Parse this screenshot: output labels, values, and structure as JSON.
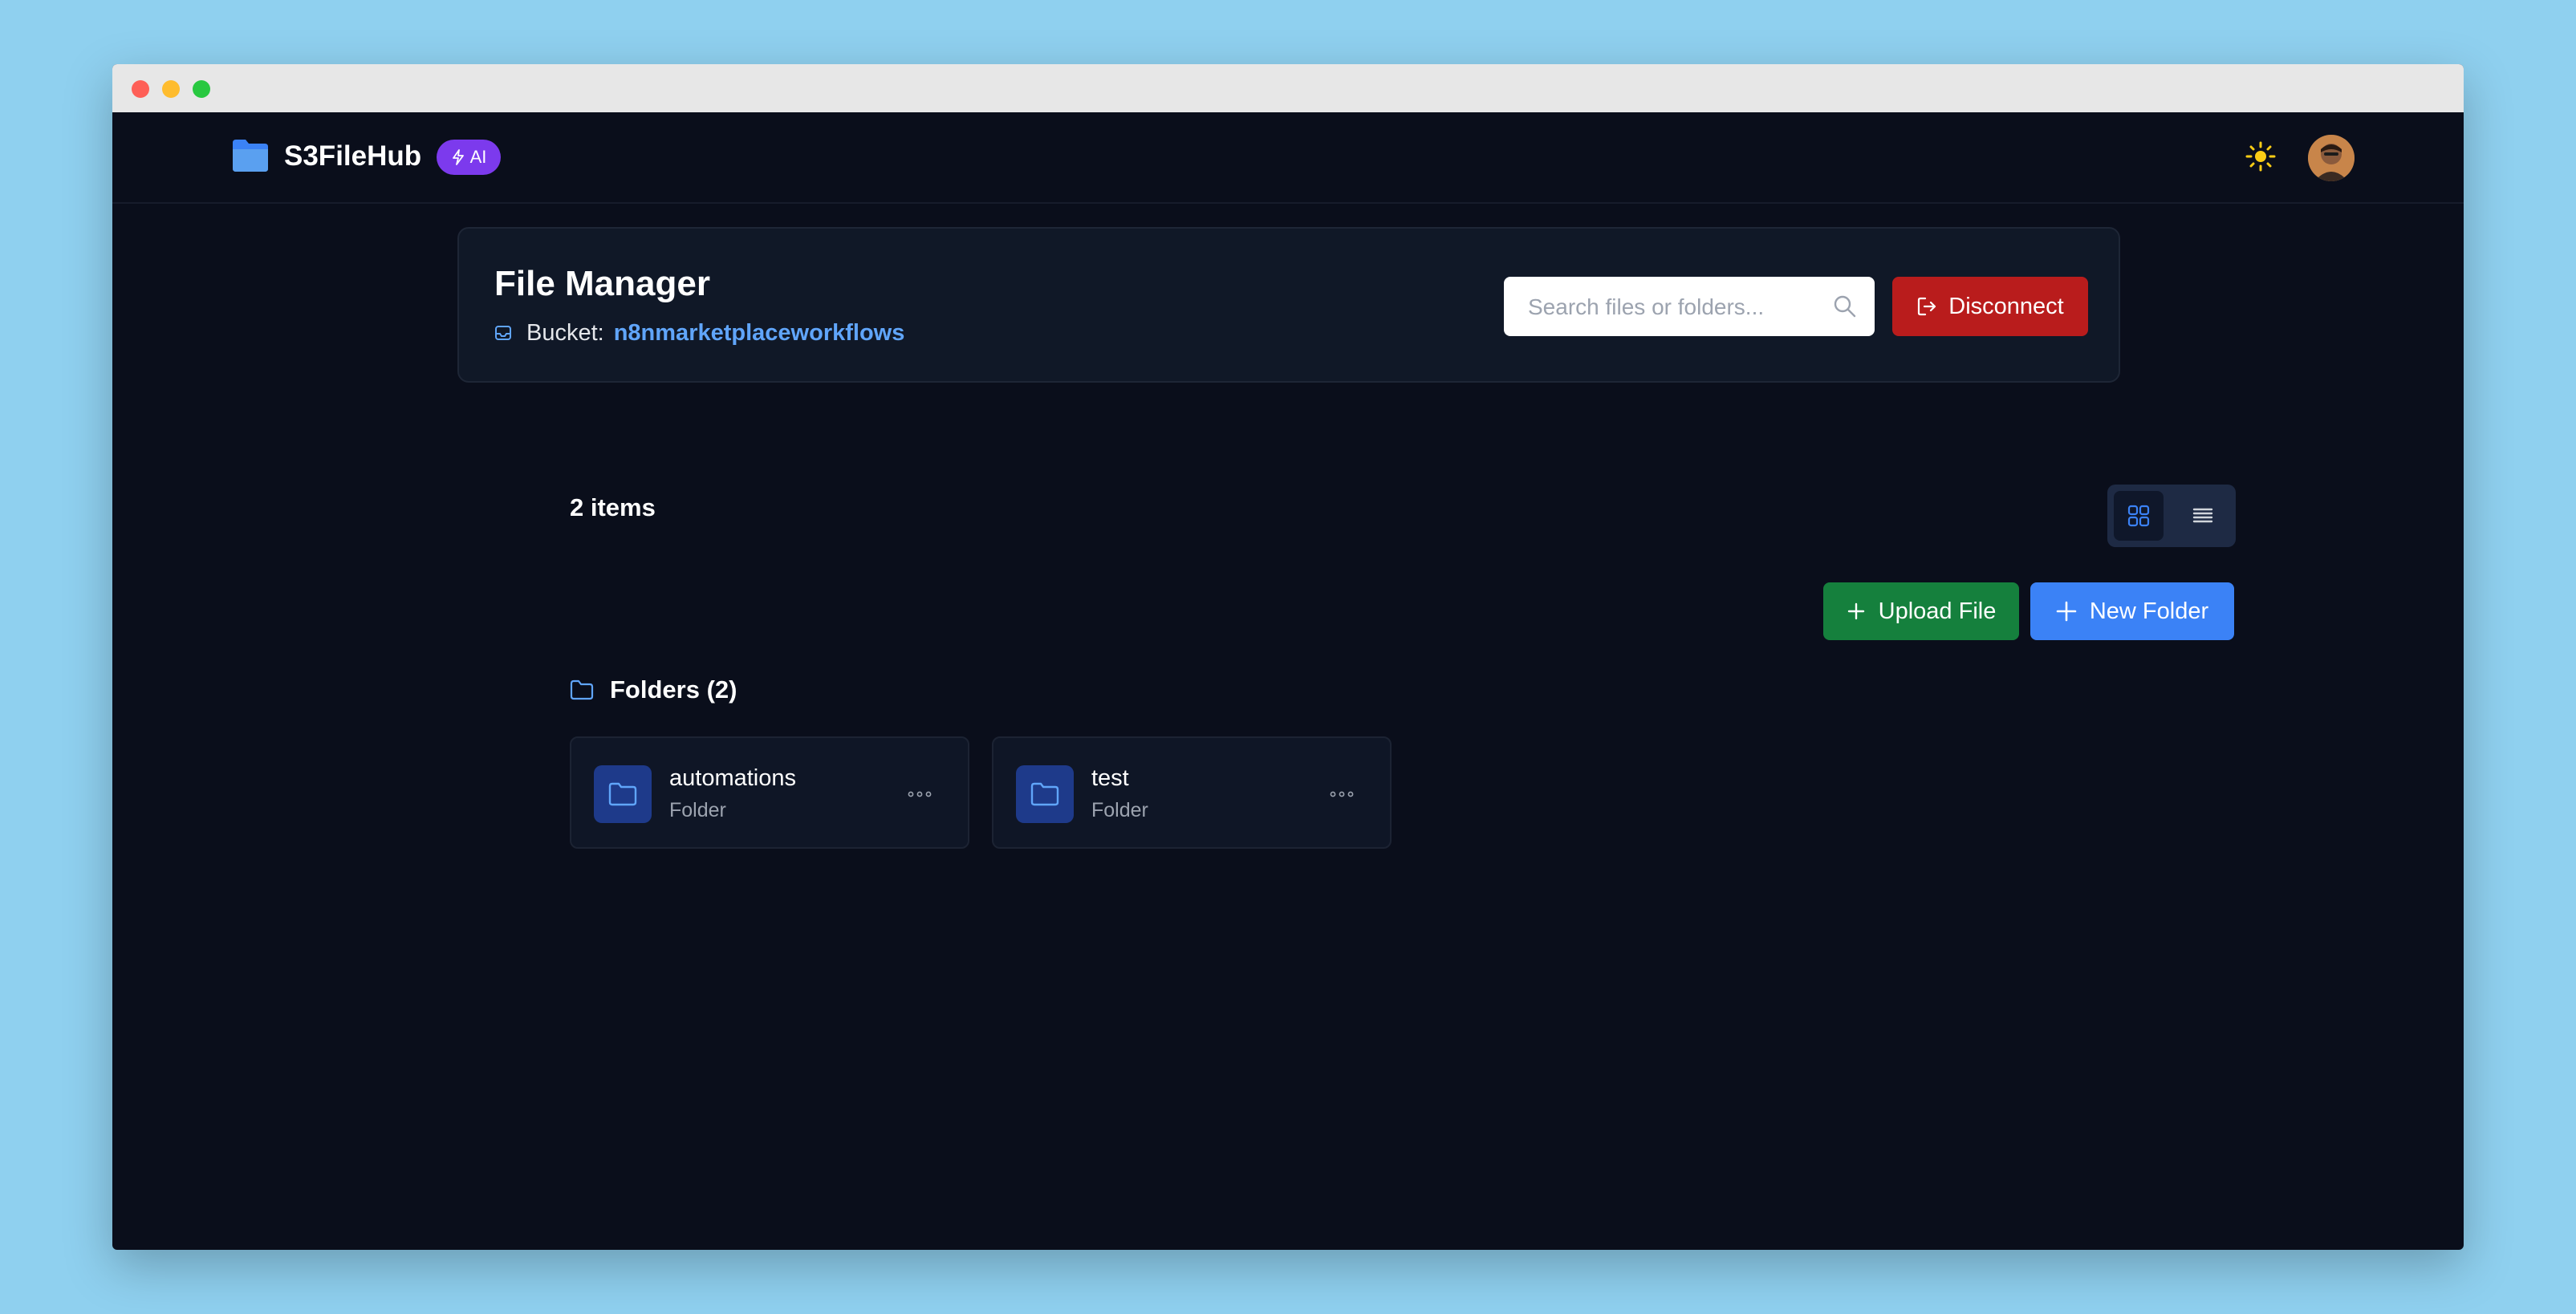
{
  "app": {
    "brand": "S3FileHub",
    "ai_badge": "AI"
  },
  "header": {
    "title": "File Manager",
    "bucket_label": "Bucket:",
    "bucket_name": "n8nmarketplaceworkflows",
    "search_placeholder": "Search files or folders...",
    "disconnect_label": "Disconnect"
  },
  "toolbar": {
    "items_count": "2 items",
    "upload_label": "Upload File",
    "new_folder_label": "New Folder",
    "active_view": "grid"
  },
  "folders": {
    "section_title": "Folders (2)",
    "items": [
      {
        "name": "automations",
        "type": "Folder"
      },
      {
        "name": "test",
        "type": "Folder"
      }
    ]
  },
  "icons": {
    "logo": "folder-logo-icon",
    "theme": "sun-icon",
    "search": "search-icon",
    "disconnect": "logout-icon",
    "grid_view": "grid-icon",
    "list_view": "list-icon",
    "upload": "plus-icon",
    "new_folder": "plus-icon",
    "section": "folder-outline-icon",
    "more": "more-horizontal-icon"
  },
  "colors": {
    "background": "#0a0e1b",
    "card": "#101827",
    "accent_blue": "#3b82f6",
    "link_blue": "#60a5fa",
    "danger": "#b91c1c",
    "success": "#15803d",
    "ai_purple": "#7c3aed",
    "folder_tile": "#1e3a8a"
  }
}
